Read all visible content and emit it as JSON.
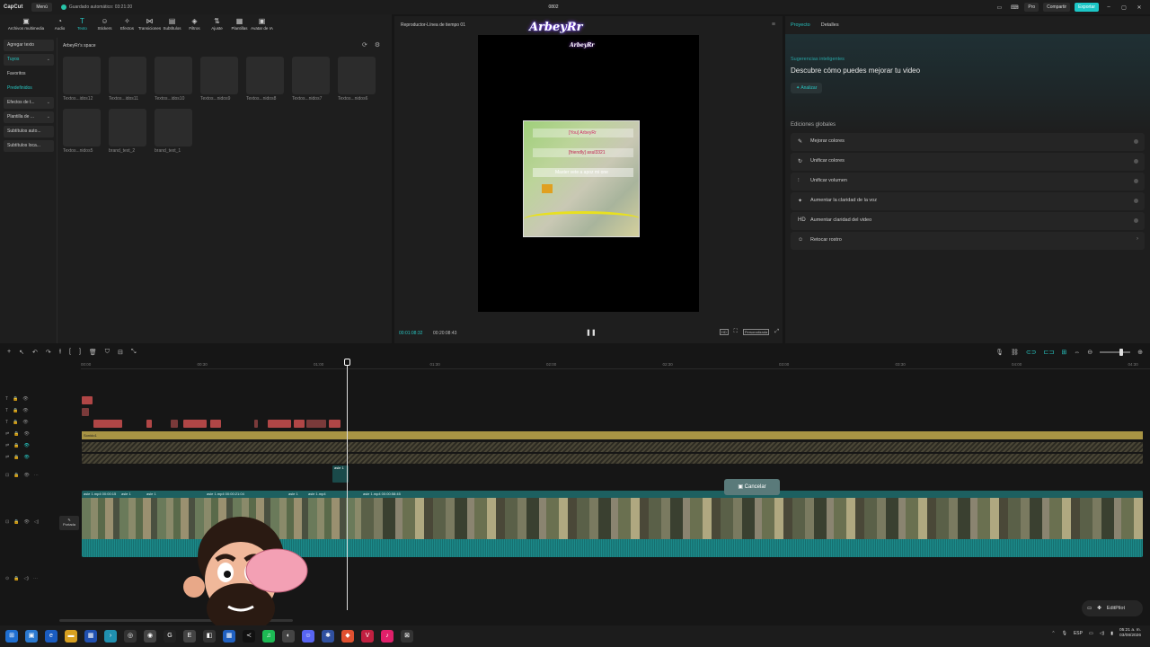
{
  "titlebar": {
    "app_name": "CapCut",
    "menu_label": "Menú",
    "autosave": "Guardado automático: 03:21:20",
    "project_title": "0802",
    "pro_label": "Pro",
    "share_label": "Compartir",
    "export_label": "Exportar"
  },
  "toolbar": [
    {
      "icon": "media-icon",
      "glyph": "▣",
      "label": "Archivos multimedia"
    },
    {
      "icon": "audio-icon",
      "glyph": "◔",
      "label": "Audio"
    },
    {
      "icon": "text-icon",
      "glyph": "T",
      "label": "Texto"
    },
    {
      "icon": "stickers-icon",
      "glyph": "☺",
      "label": "Stickers"
    },
    {
      "icon": "effects-icon",
      "glyph": "✧",
      "label": "Efectos"
    },
    {
      "icon": "transitions-icon",
      "glyph": "⋈",
      "label": "Transiciones"
    },
    {
      "icon": "subtitles-icon",
      "glyph": "▤",
      "label": "Subtítulos"
    },
    {
      "icon": "filters-icon",
      "glyph": "◈",
      "label": "Filtros"
    },
    {
      "icon": "adjust-icon",
      "glyph": "⇅",
      "label": "Ajuste"
    },
    {
      "icon": "templates-icon",
      "glyph": "▦",
      "label": "Plantillas"
    },
    {
      "icon": "ai-avatar-icon",
      "glyph": "▣",
      "label": "Avatar de IA"
    }
  ],
  "side_nav": [
    {
      "label": "Agregar texto"
    },
    {
      "label": "Tuyos"
    },
    {
      "label": "Favoritos"
    },
    {
      "label": "Predefinidos"
    },
    {
      "label": "Efectos de t..."
    },
    {
      "label": "Plantilla de ..."
    },
    {
      "label": "Subtítulos auto..."
    },
    {
      "label": "Subtítulos loca..."
    }
  ],
  "space": {
    "title": "ArbeyRr's space",
    "items": [
      "Textos...idos12",
      "Textos...idos11",
      "Textos...idos10",
      "Textos...nidos9",
      "Textos...nidos8",
      "Textos...nidos7",
      "Textos...nidos6",
      "Textos...nidos5",
      "brand_text_2",
      "brand_text_1"
    ]
  },
  "player": {
    "title": "Reproductor-Línea de tiempo 01",
    "logo": "ArbeyRr",
    "canvas_logo": "ArbeyRr",
    "overlay_line1": "[You] ArbeyRr",
    "overlay_line2": "[friendly] asul3321",
    "overlay_line3": "Master vete a apoz mi one",
    "time_current": "00:01:08:32",
    "time_total": "00:20:08:43",
    "ratio_label": "Personalizada"
  },
  "right_panel": {
    "tab_project": "Proyecto",
    "tab_details": "Detalles",
    "suggestions_heading": "Sugerencias inteligentes",
    "suggestions_title": "Descubre cómo puedes mejorar tu video",
    "analyze_label": "Analizar",
    "global_heading": "Ediciones globales",
    "options": [
      {
        "icon": "enhance-colors-icon",
        "glyph": "✎",
        "label": "Mejorar colores"
      },
      {
        "icon": "unify-colors-icon",
        "glyph": "↻",
        "label": "Unificar colores"
      },
      {
        "icon": "unify-volume-icon",
        "glyph": "⫶",
        "label": "Unificar volumen"
      },
      {
        "icon": "voice-clarity-icon",
        "glyph": "✦",
        "label": "Aumentar la claridad de la voz"
      },
      {
        "icon": "hd-icon",
        "glyph": "HD",
        "label": "Aumentar claridad del video"
      },
      {
        "icon": "retouch-face-icon",
        "glyph": "☺",
        "label": "Retocar rostro"
      }
    ]
  },
  "timeline": {
    "ruler_labels": [
      "00:00",
      "00:30",
      "01:00",
      "01:30",
      "02:00",
      "02:30",
      "03:00",
      "03:30",
      "04:00",
      "04:30"
    ],
    "yellow_clip_label": "Sonido1",
    "mini_clip_label": "asle 1",
    "video_labels": [
      "asle 1.mp4 00:00:15",
      "asle 1",
      "asle 1",
      "asle 1.mp4 00:00:21:04",
      "asle 1",
      "asle 1.mp4",
      "asle 1.mp4 00:00:58:45"
    ],
    "cover_label": "Portada",
    "cancel_label": "Cancelar",
    "editpilot_label": "EditPilot"
  },
  "taskbar": {
    "lang": "ESP",
    "time": "05:21 a. m.",
    "date": "03/08/2026"
  },
  "colors": {
    "accent": "#27c4c0",
    "export": "#1cc6c6",
    "text_clip": "#b04646",
    "audio_clip": "#a89444",
    "video_track": "#1d5a5a"
  }
}
